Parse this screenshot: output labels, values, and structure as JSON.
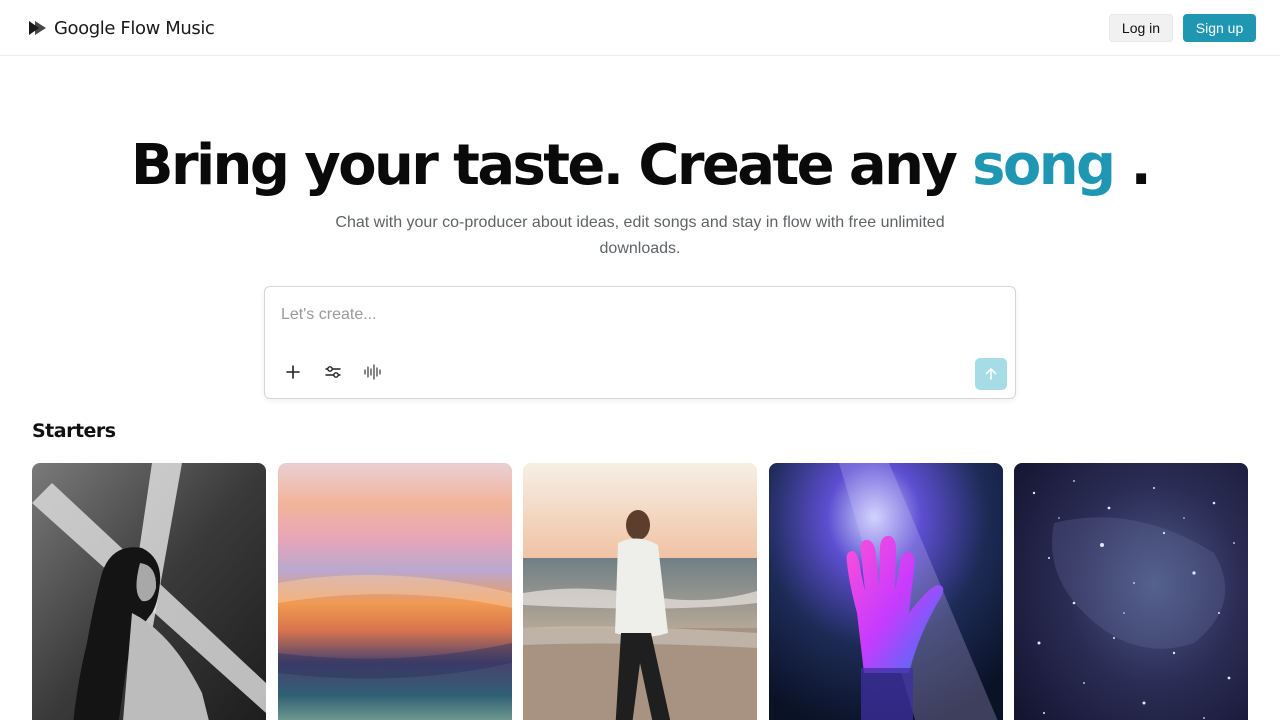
{
  "header": {
    "brand": "Google Flow Music",
    "login_label": "Log in",
    "signup_label": "Sign up",
    "accent_color": "#1f97b3"
  },
  "hero": {
    "title_main": "Bring your taste. Create any ",
    "title_accent": "song",
    "title_end": ".",
    "subtitle": "Chat with your co-producer about ideas, edit songs and stay in flow with free unlimited downloads."
  },
  "prompt": {
    "placeholder": "Let's create...",
    "value": "",
    "tools": [
      "plus-icon",
      "sliders-icon",
      "waveform-icon"
    ],
    "send_icon": "arrow-up-icon"
  },
  "starters": {
    "title": "Starters",
    "cards": [
      {
        "image": "woman-light-beam-bw"
      },
      {
        "image": "colorful-blur-gradient"
      },
      {
        "image": "man-on-beach-sunset"
      },
      {
        "image": "neon-hand-light"
      },
      {
        "image": "starry-galaxy"
      }
    ]
  }
}
